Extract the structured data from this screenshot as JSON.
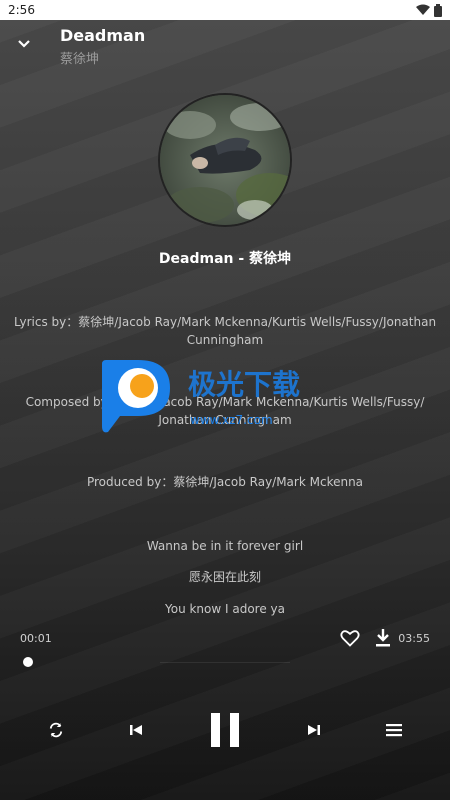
{
  "status_bar": {
    "time": "2:56",
    "icons": [
      "wifi-icon",
      "battery-icon"
    ]
  },
  "header": {
    "title": "Deadman",
    "artist": "蔡徐坤",
    "back_icon": "chevron-down-icon"
  },
  "track": {
    "name": "Deadman - 蔡徐坤"
  },
  "lyrics": {
    "credits": [
      [
        "Lyrics by：蔡徐坤/Jacob Ray/Mark Mckenna/Kurtis Wells/Fussy/Jonathan",
        "Cunningham"
      ],
      [
        "Composed by：蔡徐坤/Jacob Ray/Mark Mckenna/Kurtis Wells/Fussy/",
        "Jonathan Cunningham"
      ],
      [
        "Produced by：蔡徐坤/Jacob Ray/Mark Mckenna"
      ]
    ],
    "lines": [
      "Wanna be in it forever girl",
      "愿永困在此刻",
      "You know I adore ya"
    ]
  },
  "player": {
    "current_time": "00:01",
    "duration": "03:55",
    "progress": 0.004
  },
  "controls": {
    "icons": [
      "repeat-icon",
      "previous-icon",
      "pause-icon",
      "next-icon",
      "playlist-icon"
    ]
  },
  "watermark": {
    "text": "极光下载",
    "url": "www.xz7.com"
  },
  "colors": {
    "background_top": "#4a4a4a",
    "background_bottom": "#151515",
    "text_secondary": "#9a9a9a",
    "watermark_blue": "#1a7fe8",
    "watermark_orange": "#f7a21b"
  }
}
